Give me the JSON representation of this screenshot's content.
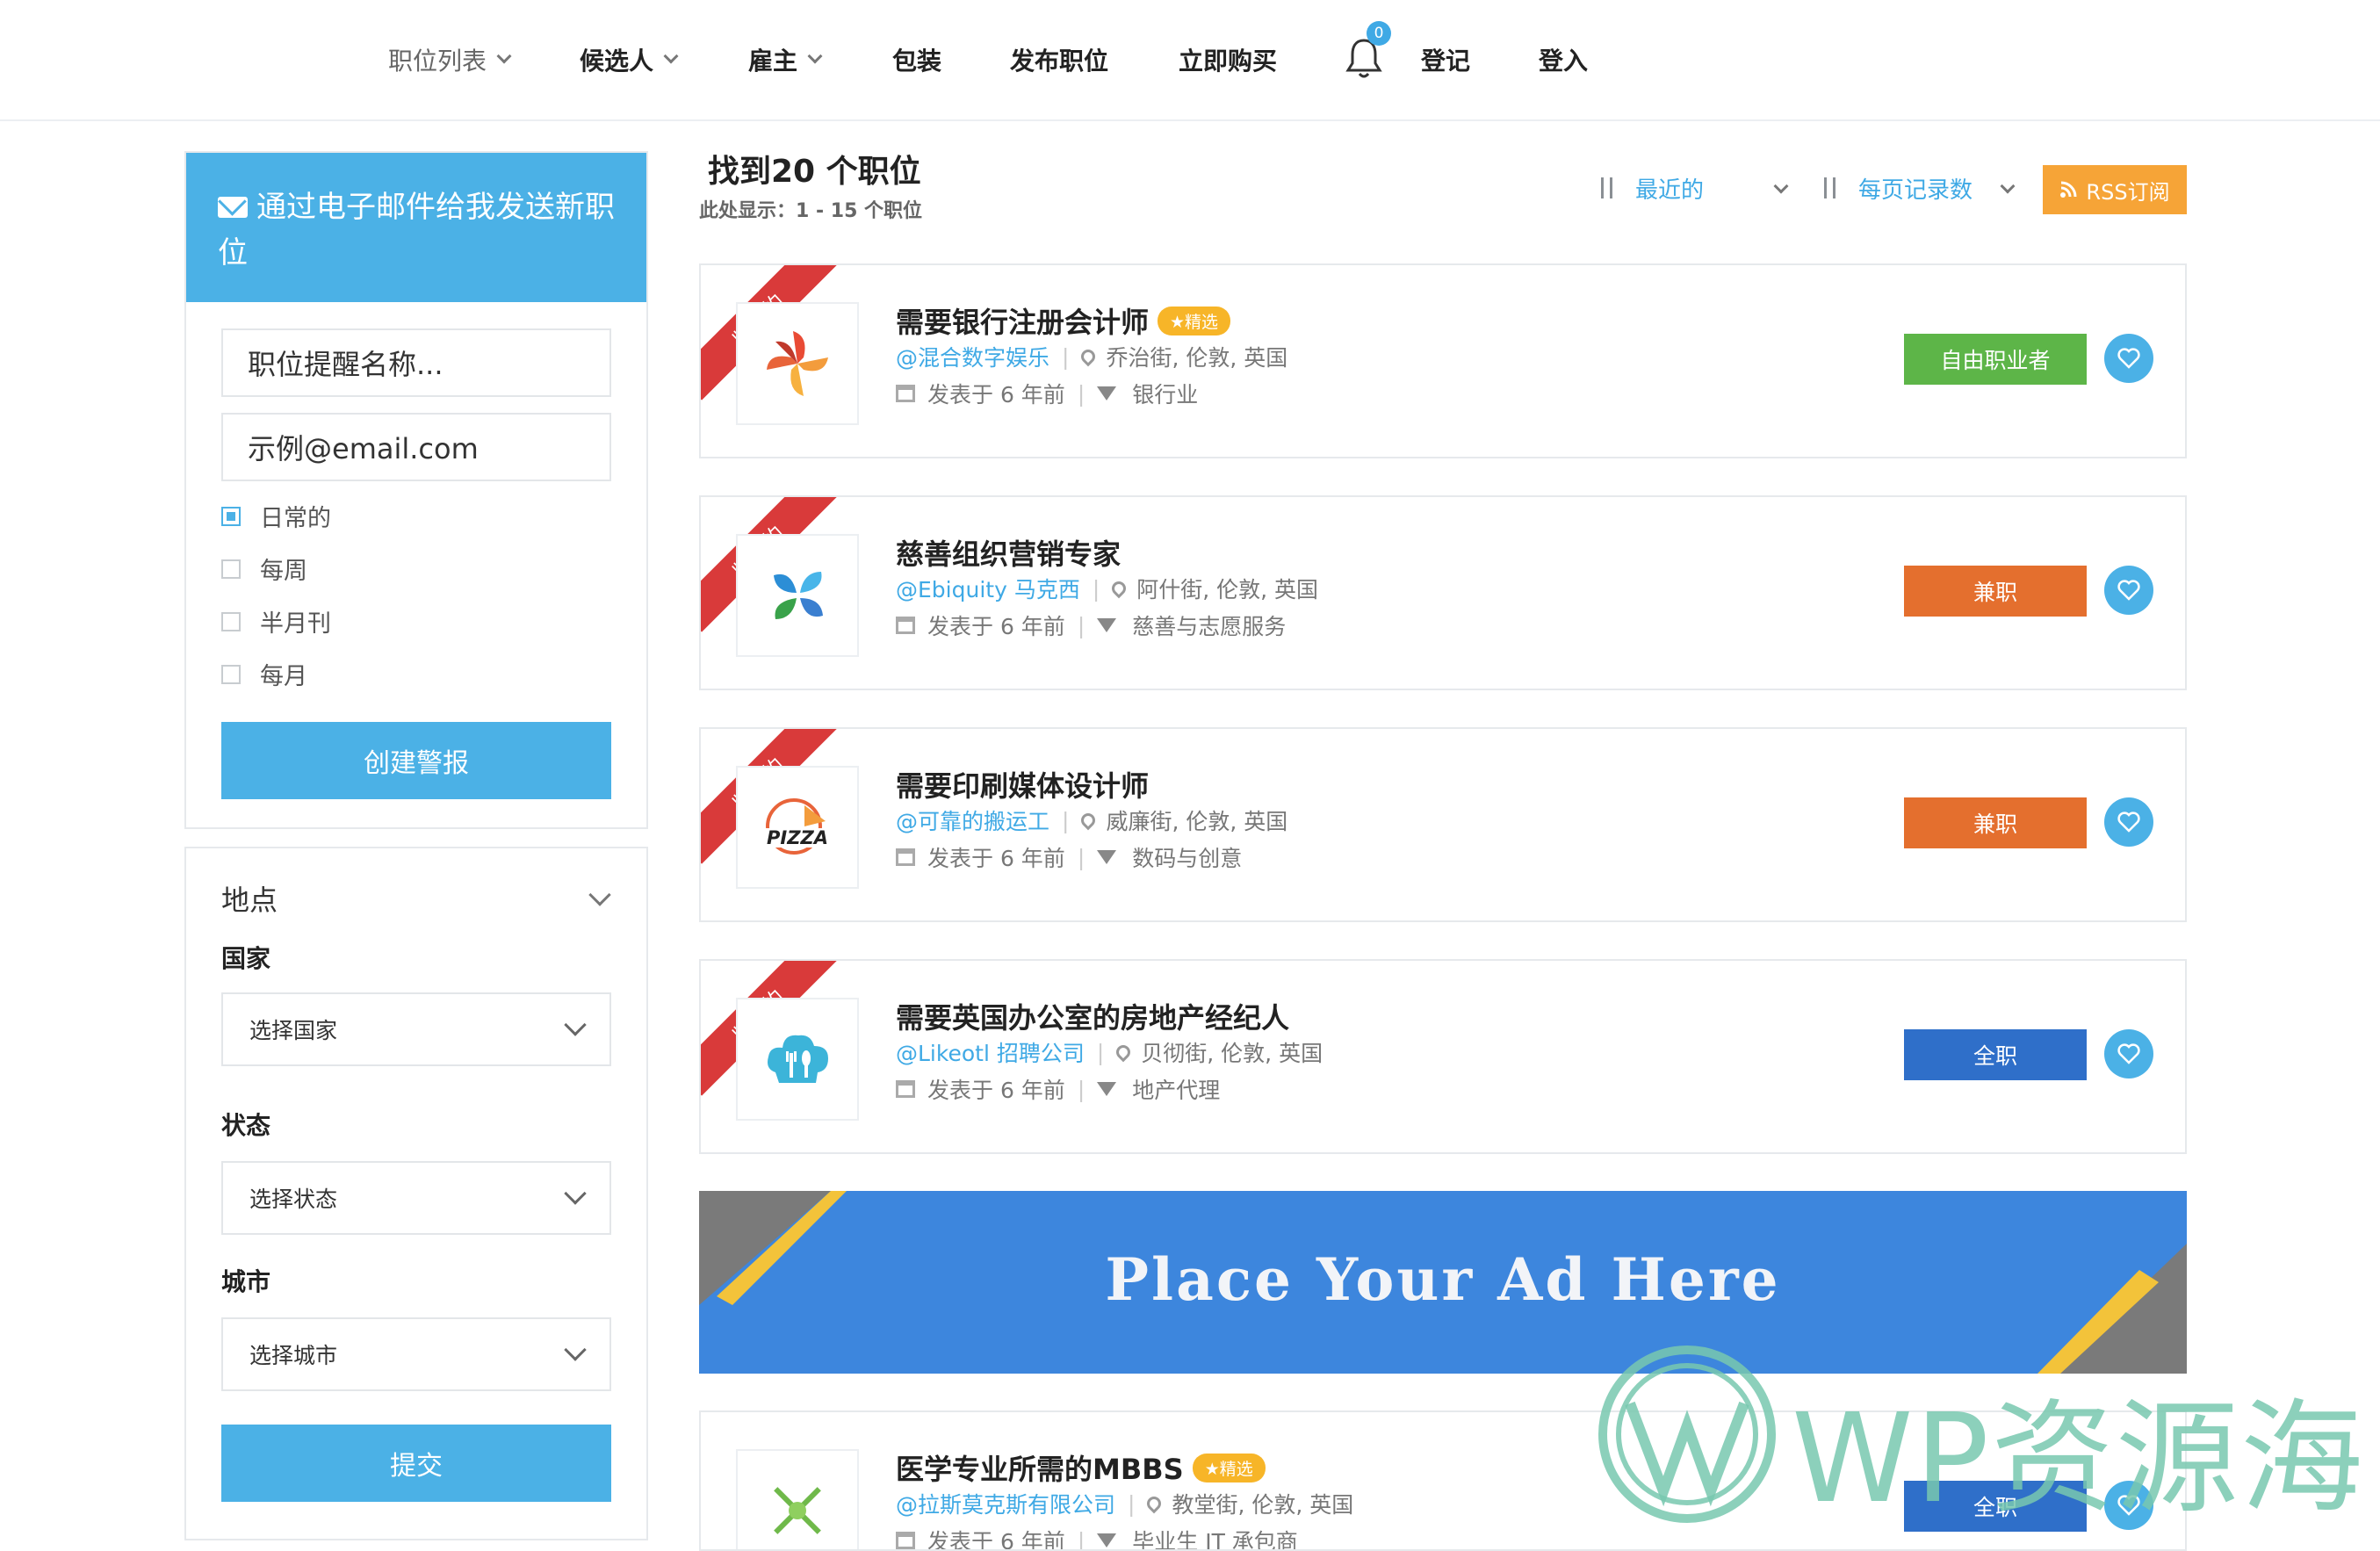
{
  "nav": {
    "items": [
      {
        "label": "职位列表",
        "dropdown": true
      },
      {
        "label": "候选人",
        "dropdown": true
      },
      {
        "label": "雇主",
        "dropdown": true
      },
      {
        "label": "包装",
        "dropdown": false
      },
      {
        "label": "发布职位",
        "dropdown": false
      },
      {
        "label": "立即购买",
        "dropdown": false
      },
      {
        "label": "登记",
        "dropdown": false
      },
      {
        "label": "登入",
        "dropdown": false
      }
    ],
    "notification_count": "0"
  },
  "alert": {
    "title": "通过电子邮件给我发送新职位",
    "name_placeholder": "职位提醒名称...",
    "email_placeholder": "示例@email.com",
    "frequency": [
      {
        "label": "日常的",
        "checked": true
      },
      {
        "label": "每周",
        "checked": false
      },
      {
        "label": "半月刊",
        "checked": false
      },
      {
        "label": "每月",
        "checked": false
      }
    ],
    "submit": "创建警报"
  },
  "location": {
    "title": "地点",
    "country_label": "国家",
    "country_select": "选择国家",
    "state_label": "状态",
    "state_select": "选择状态",
    "city_label": "城市",
    "city_select": "选择城市",
    "submit": "提交"
  },
  "results": {
    "title": "找到20 个职位",
    "subtitle": "此处显示：1 - 15 个职位",
    "sort_label": "最近的",
    "per_page_label": "每页记录数",
    "rss_label": "RSS订阅"
  },
  "jobs": [
    {
      "ribbon": "紧迫的",
      "title": "需要银行注册会计师",
      "featured": "★精选",
      "company": "@混合数字娱乐",
      "location": "乔治街, 伦敦, 英国",
      "posted": "发表于 6 年前",
      "category": "银行业",
      "type": "自由职业者",
      "type_color": "#5db548"
    },
    {
      "ribbon": "紧迫的",
      "title": "慈善组织营销专家",
      "featured": "",
      "company": "@Ebiquity 马克西",
      "location": "阿什街, 伦敦, 英国",
      "posted": "发表于 6 年前",
      "category": "慈善与志愿服务",
      "type": "兼职",
      "type_color": "#e46f2e"
    },
    {
      "ribbon": "紧迫的",
      "title": "需要印刷媒体设计师",
      "featured": "",
      "company": "@可靠的搬运工",
      "location": "威廉街, 伦敦, 英国",
      "posted": "发表于 6 年前",
      "category": "数码与创意",
      "type": "兼职",
      "type_color": "#e46f2e"
    },
    {
      "ribbon": "紧迫的",
      "title": "需要英国办公室的房地产经纪人",
      "featured": "",
      "company": "@Likeotl 招聘公司",
      "location": "贝彻街, 伦敦, 英国",
      "posted": "发表于 6 年前",
      "category": "地产代理",
      "type": "全职",
      "type_color": "#2f6fc9"
    },
    {
      "ribbon": "",
      "title": "医学专业所需的MBBS",
      "featured": "★精选",
      "company": "@拉斯莫克斯有限公司",
      "location": "教堂街, 伦敦, 英国",
      "posted": "发表于 6 年前",
      "category": "毕业生 IT 承包商",
      "type": "全职",
      "type_color": "#2f6fc9"
    }
  ],
  "ad": {
    "text": "Place Your Ad Here"
  },
  "watermark": {
    "text": "WP资源海"
  },
  "logo_text": {
    "pizza": "PIZZA"
  },
  "icons": [
    "chevron-down-icon",
    "bell-icon",
    "envelope-icon",
    "sort-icon",
    "rss-icon",
    "map-pin-icon",
    "calendar-icon",
    "filter-icon",
    "heart-icon",
    "wordpress-icon"
  ]
}
